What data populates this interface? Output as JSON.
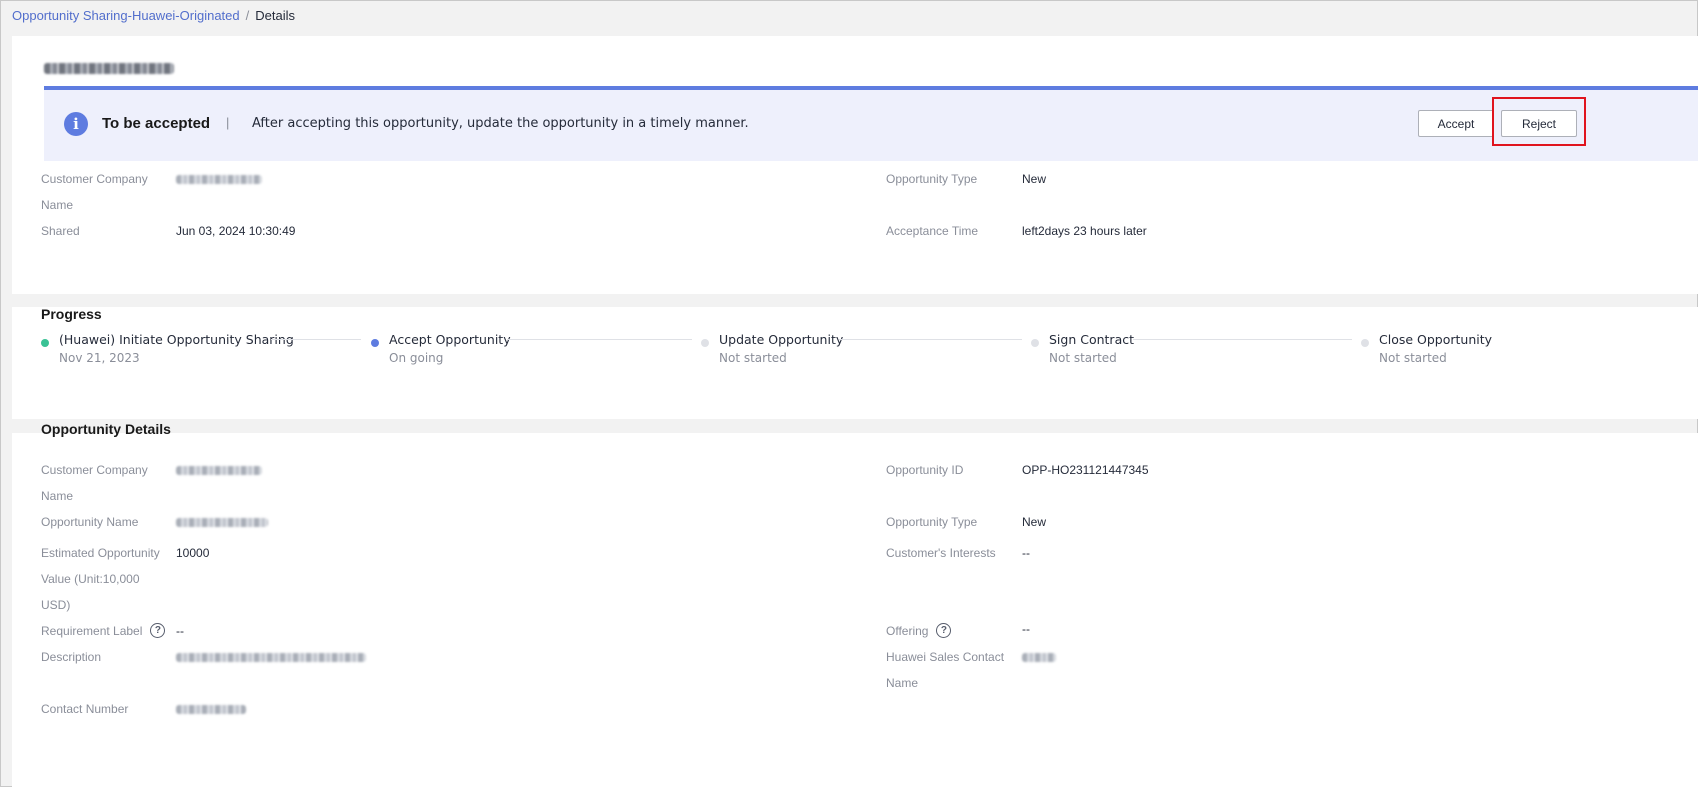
{
  "breadcrumb": {
    "parent": "Opportunity Sharing-Huawei-Originated",
    "separator": "/",
    "current": "Details"
  },
  "banner": {
    "status": "To be accepted",
    "separator": "|",
    "message": "After accepting this opportunity, update the opportunity in a timely manner.",
    "accept_label": "Accept",
    "reject_label": "Reject",
    "accent_color": "#5e7ce0",
    "highlight_color": "#e0141e"
  },
  "summary": {
    "customer_company_label_1": "Customer Company",
    "customer_company_label_2": "Name",
    "shared_label": "Shared",
    "shared_value": "Jun 03, 2024 10:30:49",
    "opportunity_type_label": "Opportunity Type",
    "opportunity_type_value": "New",
    "acceptance_time_label": "Acceptance Time",
    "acceptance_time_value": "left2days 23 hours later"
  },
  "progress": {
    "title": "Progress",
    "steps": [
      {
        "name": "(Huawei) Initiate Opportunity Sharing",
        "status": "Nov 21, 2023",
        "state": "done"
      },
      {
        "name": "Accept Opportunity",
        "status": "On going",
        "state": "active"
      },
      {
        "name": "Update Opportunity",
        "status": "Not started",
        "state": "pending"
      },
      {
        "name": "Sign Contract",
        "status": "Not started",
        "state": "pending"
      },
      {
        "name": "Close Opportunity",
        "status": "Not started",
        "state": "pending"
      }
    ]
  },
  "details": {
    "title": "Opportunity Details",
    "customer_company_label_1": "Customer Company",
    "customer_company_label_2": "Name",
    "opportunity_name_label": "Opportunity Name",
    "estimated_value_label_1": "Estimated Opportunity",
    "estimated_value_label_2": "Value (Unit:10,000",
    "estimated_value_label_3": "USD)",
    "estimated_value": "10000",
    "requirement_label_label": "Requirement Label",
    "requirement_label_value": "--",
    "description_label": "Description",
    "contact_number_label": "Contact Number",
    "opportunity_id_label": "Opportunity ID",
    "opportunity_id_value": "OPP-HO231121447345",
    "opportunity_type_label": "Opportunity Type",
    "opportunity_type_value": "New",
    "customer_interests_label": "Customer's Interests",
    "customer_interests_value": "--",
    "offering_label": "Offering",
    "offering_value": "--",
    "sales_contact_label_1": "Huawei Sales Contact",
    "sales_contact_label_2": "Name",
    "help_glyph": "?"
  }
}
